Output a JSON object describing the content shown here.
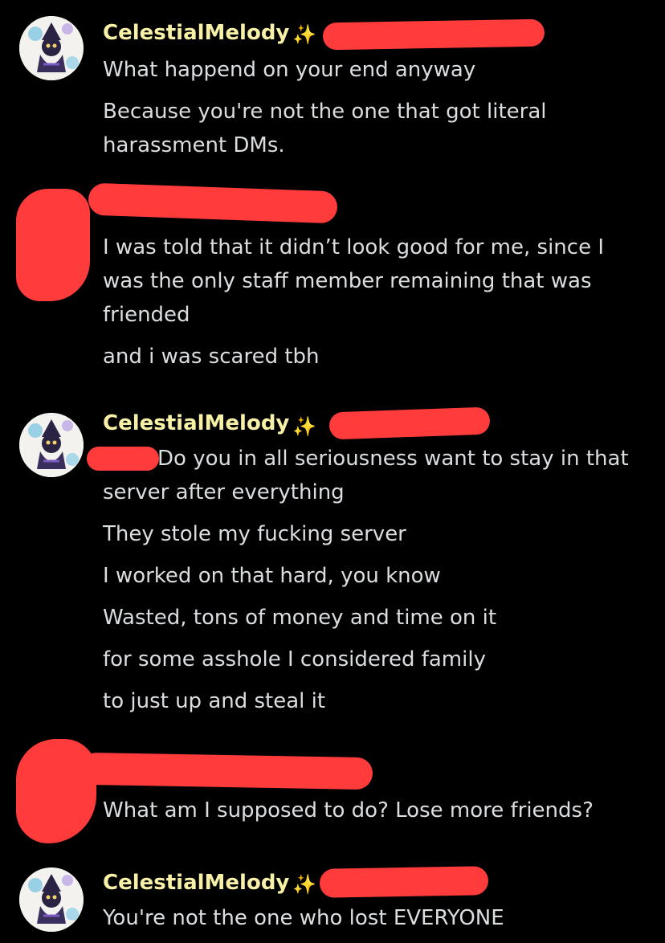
{
  "colors": {
    "background": "#000000",
    "username": "#f7f0a6",
    "text": "#dbdee1",
    "redaction": "#ff3b3b"
  },
  "messages": [
    {
      "username": "CelestialMelody",
      "badge_icon": "sparkles-icon",
      "lines": [
        "What happend on your end anyway",
        "Because you're not the one that got literal",
        "harassment DMs."
      ]
    },
    {
      "username": "",
      "lines": [
        "I was told that it didn’t look good for me, since I",
        "was the only staff member remaining that was",
        "friended",
        "and i was scared tbh"
      ]
    },
    {
      "username": "CelestialMelody",
      "badge_icon": "sparkles-icon",
      "lines": [
        "Do you in all seriousness want to stay in that",
        "server after everything",
        "They stole my fucking server",
        "I worked on that hard, you know",
        "Wasted, tons of money and time on it",
        "for some asshole I considered family",
        "to just up and steal it"
      ]
    },
    {
      "username": "",
      "lines": [
        "What am I supposed to do? Lose more friends?"
      ]
    },
    {
      "username": "CelestialMelody",
      "badge_icon": "sparkles-icon",
      "lines": [
        "You're not the one who lost EVERYONE"
      ]
    }
  ]
}
